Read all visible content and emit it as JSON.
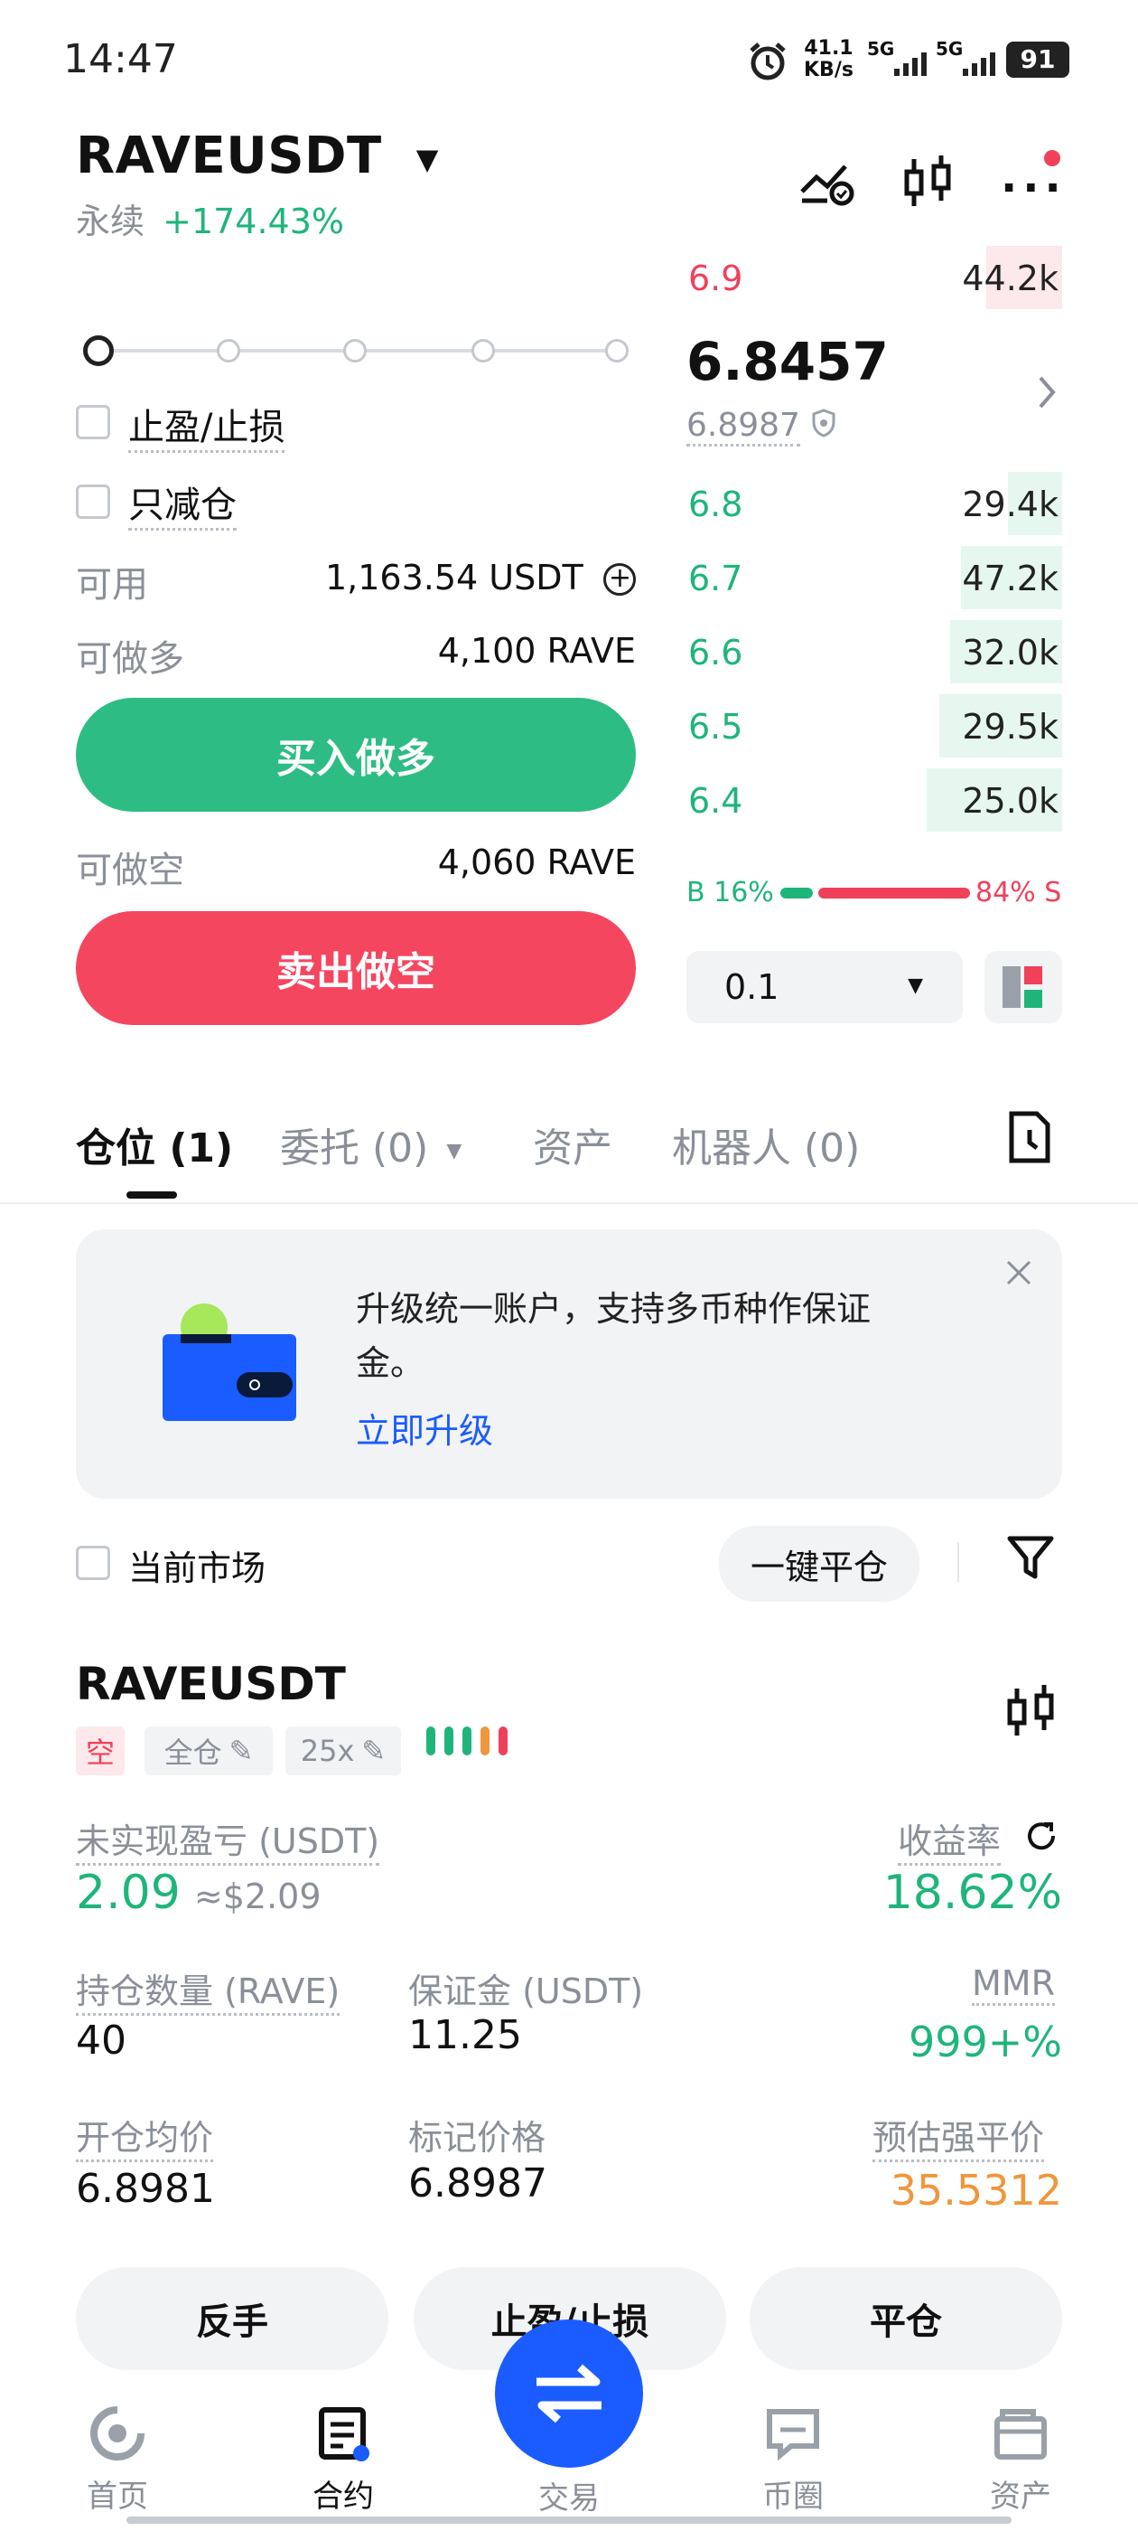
{
  "status_bar": {
    "time": "14:47",
    "net_speed": "41.1",
    "net_unit": "KB/s",
    "sim1": "5G",
    "sim2": "5G",
    "battery": "91"
  },
  "header": {
    "pair": "RAVEUSDT",
    "type": "永续",
    "change": "+174.43%"
  },
  "order_form": {
    "tpsl_label": "止盈/止损",
    "reduce_only_label": "只减仓",
    "available_label": "可用",
    "available_value": "1,163.54 USDT",
    "can_long_label": "可做多",
    "can_long_value": "4,100 RAVE",
    "buy_button": "买入做多",
    "can_short_label": "可做空",
    "can_short_value": "4,060 RAVE",
    "sell_button": "卖出做空"
  },
  "orderbook": {
    "asks": [
      {
        "price": "6.9",
        "qty": "44.2k",
        "depth": 0.2
      }
    ],
    "last_price": "6.8457",
    "mark_price": "6.8987",
    "bids": [
      {
        "price": "6.8",
        "qty": "29.4k",
        "depth": 0.15
      },
      {
        "price": "6.7",
        "qty": "47.2k",
        "depth": 0.27
      },
      {
        "price": "6.6",
        "qty": "32.0k",
        "depth": 0.29
      },
      {
        "price": "6.5",
        "qty": "29.5k",
        "depth": 0.31
      },
      {
        "price": "6.4",
        "qty": "25.0k",
        "depth": 0.33
      }
    ],
    "buy_ratio_label": "B 16%",
    "sell_ratio_label": "84% S",
    "buy_ratio": 0.16,
    "precision": "0.1"
  },
  "tabs": [
    {
      "label": "仓位 (1)",
      "active": true
    },
    {
      "label": "委托 (0)",
      "active": false
    },
    {
      "label": "资产",
      "active": false
    },
    {
      "label": "机器人 (0)",
      "active": false
    }
  ],
  "promo": {
    "text_line1": "升级统一账户，支持多币种作保证",
    "text_line2": "金。",
    "link": "立即升级"
  },
  "filter": {
    "current_market_label": "当前市场",
    "close_all_label": "一键平仓"
  },
  "position": {
    "pair": "RAVEUSDT",
    "side_tag": "空",
    "margin_tag": "全仓",
    "leverage_tag": "25x",
    "upnl_label": "未实现盈亏 (USDT)",
    "upnl_value": "2.09",
    "upnl_usd": "≈$2.09",
    "roe_label": "收益率",
    "roe_value": "18.62%",
    "size_label": "持仓数量 (RAVE)",
    "size_value": "40",
    "margin_label": "保证金 (USDT)",
    "margin_value": "11.25",
    "mmr_label": "MMR",
    "mmr_value": "999+%",
    "entry_label": "开仓均价",
    "entry_value": "6.8981",
    "mark_label": "标记价格",
    "mark_value": "6.8987",
    "liq_label": "预估强平价",
    "liq_value": "35.5312",
    "btn_reverse": "反手",
    "btn_tpsl": "止盈/止损",
    "btn_close": "平仓"
  },
  "bottom_nav": [
    {
      "label": "首页",
      "icon": "home-icon",
      "active": false
    },
    {
      "label": "合约",
      "icon": "contract-icon",
      "active": true
    },
    {
      "label": "交易",
      "icon": "trade-swap-icon",
      "active": false
    },
    {
      "label": "币圈",
      "icon": "community-icon",
      "active": false
    },
    {
      "label": "资产",
      "icon": "wallet-icon",
      "active": false
    }
  ],
  "colors": {
    "green": "#1fb57a",
    "red": "#f0405a",
    "orange": "#f0963c",
    "blue": "#1a5cff"
  }
}
